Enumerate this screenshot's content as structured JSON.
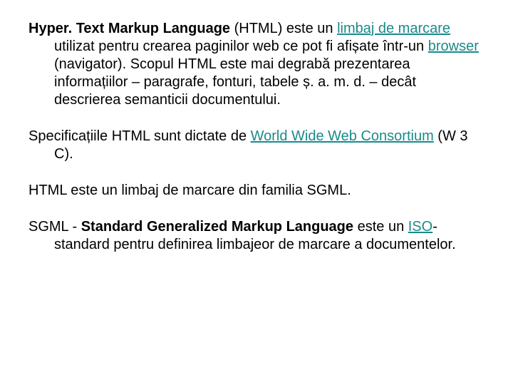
{
  "p1": {
    "b1": "Hyper. Text Markup Language",
    "t1": " (HTML) este un ",
    "l1": "limbaj de marcare",
    "t2": " utilizat pentru crearea paginilor web ce pot fi afișate într-un ",
    "l2": "browser",
    "t3": " (navigator). Scopul HTML este mai degrabă prezentarea informațiilor – paragrafe, fonturi, tabele ș. a. m. d. – decât descrierea semanticii documentului."
  },
  "p2": {
    "t1": "Specificațiile HTML sunt dictate de ",
    "l1": "World Wide Web Consortium",
    "t2": " (W 3 C)."
  },
  "p3": {
    "t1": "HTML este un limbaj de marcare din familia SGML."
  },
  "p4": {
    "t1": " SGML - ",
    "b1": "Standard Generalized Markup Language",
    "t2": "  este un ",
    "l1": "ISO",
    "t3": "-standard pentru definirea limbajeor de marcare a documentelor."
  }
}
